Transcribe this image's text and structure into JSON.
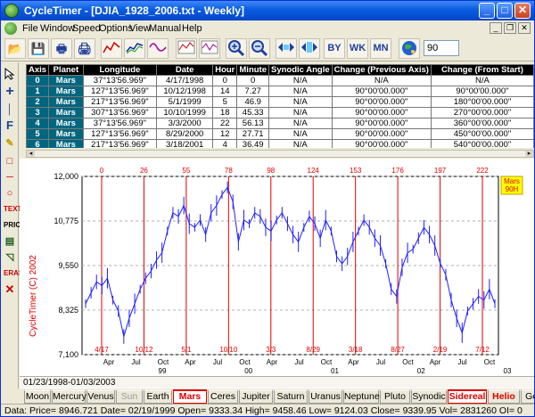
{
  "window": {
    "title": "CycleTimer - [DJIA_1928_2006.txt - Weekly]",
    "min_label": "_",
    "max_label": "□",
    "close_label": "✕"
  },
  "menu": [
    "File",
    "Window",
    "Speed",
    "Options",
    "View",
    "Manual",
    "Help"
  ],
  "toolbar": {
    "buttons": [
      "open-folder",
      "save-disk",
      "print",
      "print-preview",
      "line-chart",
      "candle-chart",
      "zoom-in",
      "zoom-out",
      "scroll-left-right",
      "scroll-fit",
      "by-scale",
      "wk-scale",
      "mn-scale",
      "globe"
    ],
    "labels": {
      "by": "BY",
      "wk": "WK",
      "mn": "MN"
    },
    "zoom_value": "90"
  },
  "grid": {
    "columns": [
      "Axis",
      "Planet",
      "Longitude",
      "Date",
      "Hour",
      "Minute",
      "Synodic Angle",
      "Change (Previous Axis)",
      "Change (From Start)"
    ],
    "rows": [
      [
        "0",
        "Mars",
        "37°13'56.969\"",
        "4/17/1998",
        "0",
        "0",
        "N/A",
        "N/A",
        "N/A"
      ],
      [
        "1",
        "Mars",
        "127°13'56.969\"",
        "10/12/1998",
        "14",
        "7.27",
        "N/A",
        "90°00'00.000\"",
        "90°00'00.000\""
      ],
      [
        "2",
        "Mars",
        "217°13'56.969\"",
        "5/1/1999",
        "5",
        "46.9",
        "N/A",
        "90°00'00.000\"",
        "180°00'00.000\""
      ],
      [
        "3",
        "Mars",
        "307°13'56.969\"",
        "10/10/1999",
        "18",
        "45.33",
        "N/A",
        "90°00'00.000\"",
        "270°00'00.000\""
      ],
      [
        "4",
        "Mars",
        "37°13'56.969\"",
        "3/3/2000",
        "22",
        "56.13",
        "N/A",
        "90°00'00.000\"",
        "360°00'00.000\""
      ],
      [
        "5",
        "Mars",
        "127°13'56.969\"",
        "8/29/2000",
        "12",
        "27.71",
        "N/A",
        "90°00'00.000\"",
        "450°00'00.000\""
      ],
      [
        "6",
        "Mars",
        "217°13'56.969\"",
        "3/18/2001",
        "4",
        "36.49",
        "N/A",
        "90°00'00.000\"",
        "540°00'00.000\""
      ]
    ]
  },
  "chart_data": {
    "type": "line",
    "title": "",
    "legend": "Mars\n90H",
    "legend_lines": [
      "Mars",
      "90H"
    ],
    "ylim": [
      7100,
      12000
    ],
    "yticks": [
      12000,
      10775,
      9550,
      8325,
      7100
    ],
    "ytick_labels": [
      "12,000",
      "10,775",
      "9,550",
      "8,325",
      "7,100"
    ],
    "watermark": "CycleTimer (C) 2002",
    "date_range_label": "01/23/1998-01/03/2003",
    "x_month_labels": [
      "Apr",
      "Jul",
      "Oct",
      "Apr",
      "Jul",
      "Oct",
      "Apr",
      "Jul",
      "Oct",
      "Apr",
      "Jul",
      "Oct",
      "Apr",
      "Jul",
      "Oct"
    ],
    "x_year_labels": [
      "99",
      "00",
      "01",
      "02",
      "03"
    ],
    "bar_numbers": [
      "0",
      "26",
      "55",
      "78",
      "98",
      "124",
      "153",
      "176",
      "197",
      "222"
    ],
    "bar_dates": [
      "4/17",
      "10/12",
      "5/1",
      "10/10",
      "3/3",
      "8/29",
      "3/18",
      "8/27",
      "2/19",
      "7/12"
    ],
    "series": [
      {
        "values": [
          8500,
          8800,
          9100,
          9000,
          9200,
          8600,
          8300,
          7600,
          8100,
          8500,
          8900,
          9200,
          9400,
          9700,
          9900,
          10500,
          11000,
          10900,
          11200,
          10700,
          10600,
          10800,
          10400,
          11000,
          11200,
          11500,
          11700,
          11300,
          10200,
          10800,
          10700,
          11000,
          10900,
          10600,
          10500,
          10800,
          11000,
          10700,
          10400,
          10200,
          10600,
          10900,
          10700,
          10300,
          10800,
          10500,
          9800,
          9600,
          9800,
          10200,
          10500,
          10800,
          10600,
          10300,
          10100,
          9600,
          8900,
          8700,
          9500,
          9900,
          10000,
          10300,
          10600,
          10400,
          10100,
          9600,
          9300,
          8600,
          8100,
          7700,
          8300,
          8500,
          8700,
          8600,
          8900,
          8500
        ]
      }
    ]
  },
  "date_strip": "01/23/1998-01/03/2003",
  "tabs": [
    {
      "label": "Moon",
      "style": "normal"
    },
    {
      "label": "Mercury",
      "style": "normal"
    },
    {
      "label": "Venus",
      "style": "normal"
    },
    {
      "label": "Sun",
      "style": "grey"
    },
    {
      "label": "Earth",
      "style": "normal"
    },
    {
      "label": "Mars",
      "style": "red-active"
    },
    {
      "label": "Ceres",
      "style": "normal"
    },
    {
      "label": "Jupiter",
      "style": "normal"
    },
    {
      "label": "Saturn",
      "style": "normal"
    },
    {
      "label": "Uranus",
      "style": "normal"
    },
    {
      "label": "Neptune",
      "style": "normal"
    },
    {
      "label": "Pluto",
      "style": "normal"
    },
    {
      "label": "Synodic",
      "style": "normal"
    },
    {
      "label": "Sidereal",
      "style": "red-active"
    },
    {
      "label": "Helio",
      "style": "red"
    },
    {
      "label": "Geo",
      "style": "normal"
    }
  ],
  "status": "Data:   Price= 8946.721  Date= 02/19/1999  Open= 9333.34  High= 9458.46  Low= 9124.03  Close= 9339.95  Vol= 2831260  OI= 0",
  "colors": {
    "titlebar": "#0a5ce0",
    "grid_header": "#000000",
    "axis_cell": "#006680",
    "price_line": "#2020ff",
    "cycle_line": "#e00000"
  }
}
